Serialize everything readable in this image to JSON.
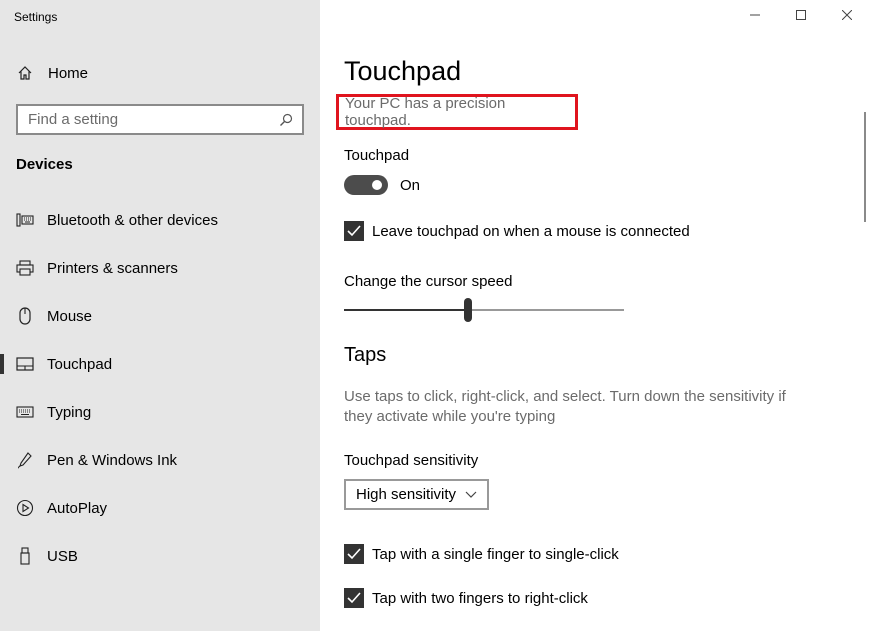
{
  "window": {
    "title": "Settings"
  },
  "sidebar": {
    "home_label": "Home",
    "search_placeholder": "Find a setting",
    "section_title": "Devices",
    "items": [
      {
        "label": "Bluetooth & other devices",
        "icon": "bluetooth-devices-icon"
      },
      {
        "label": "Printers & scanners",
        "icon": "printer-icon"
      },
      {
        "label": "Mouse",
        "icon": "mouse-icon"
      },
      {
        "label": "Touchpad",
        "icon": "touchpad-icon",
        "selected": true
      },
      {
        "label": "Typing",
        "icon": "keyboard-icon"
      },
      {
        "label": "Pen & Windows Ink",
        "icon": "pen-icon"
      },
      {
        "label": "AutoPlay",
        "icon": "autoplay-icon"
      },
      {
        "label": "USB",
        "icon": "usb-icon"
      }
    ]
  },
  "main": {
    "title": "Touchpad",
    "subtitle": "Your PC has a precision touchpad.",
    "touchpad_label": "Touchpad",
    "toggle_state": "On",
    "toggle_on": true,
    "leave_on_label": "Leave touchpad on when a mouse is connected",
    "leave_on_checked": true,
    "cursor_speed_label": "Change the cursor speed",
    "cursor_speed_fraction": 0.44,
    "taps_heading": "Taps",
    "taps_description": "Use taps to click, right-click, and select. Turn down the sensitivity if they activate while you're typing",
    "sensitivity_label": "Touchpad sensitivity",
    "sensitivity_value": "High sensitivity",
    "tap_single_label": "Tap with a single finger to single-click",
    "tap_single_checked": true,
    "tap_two_label": "Tap with two fingers to right-click",
    "tap_two_checked": true
  },
  "colors": {
    "highlight_box": "#e0141e",
    "sidebar_bg": "#e6e6e6",
    "control_dark": "#333333"
  }
}
